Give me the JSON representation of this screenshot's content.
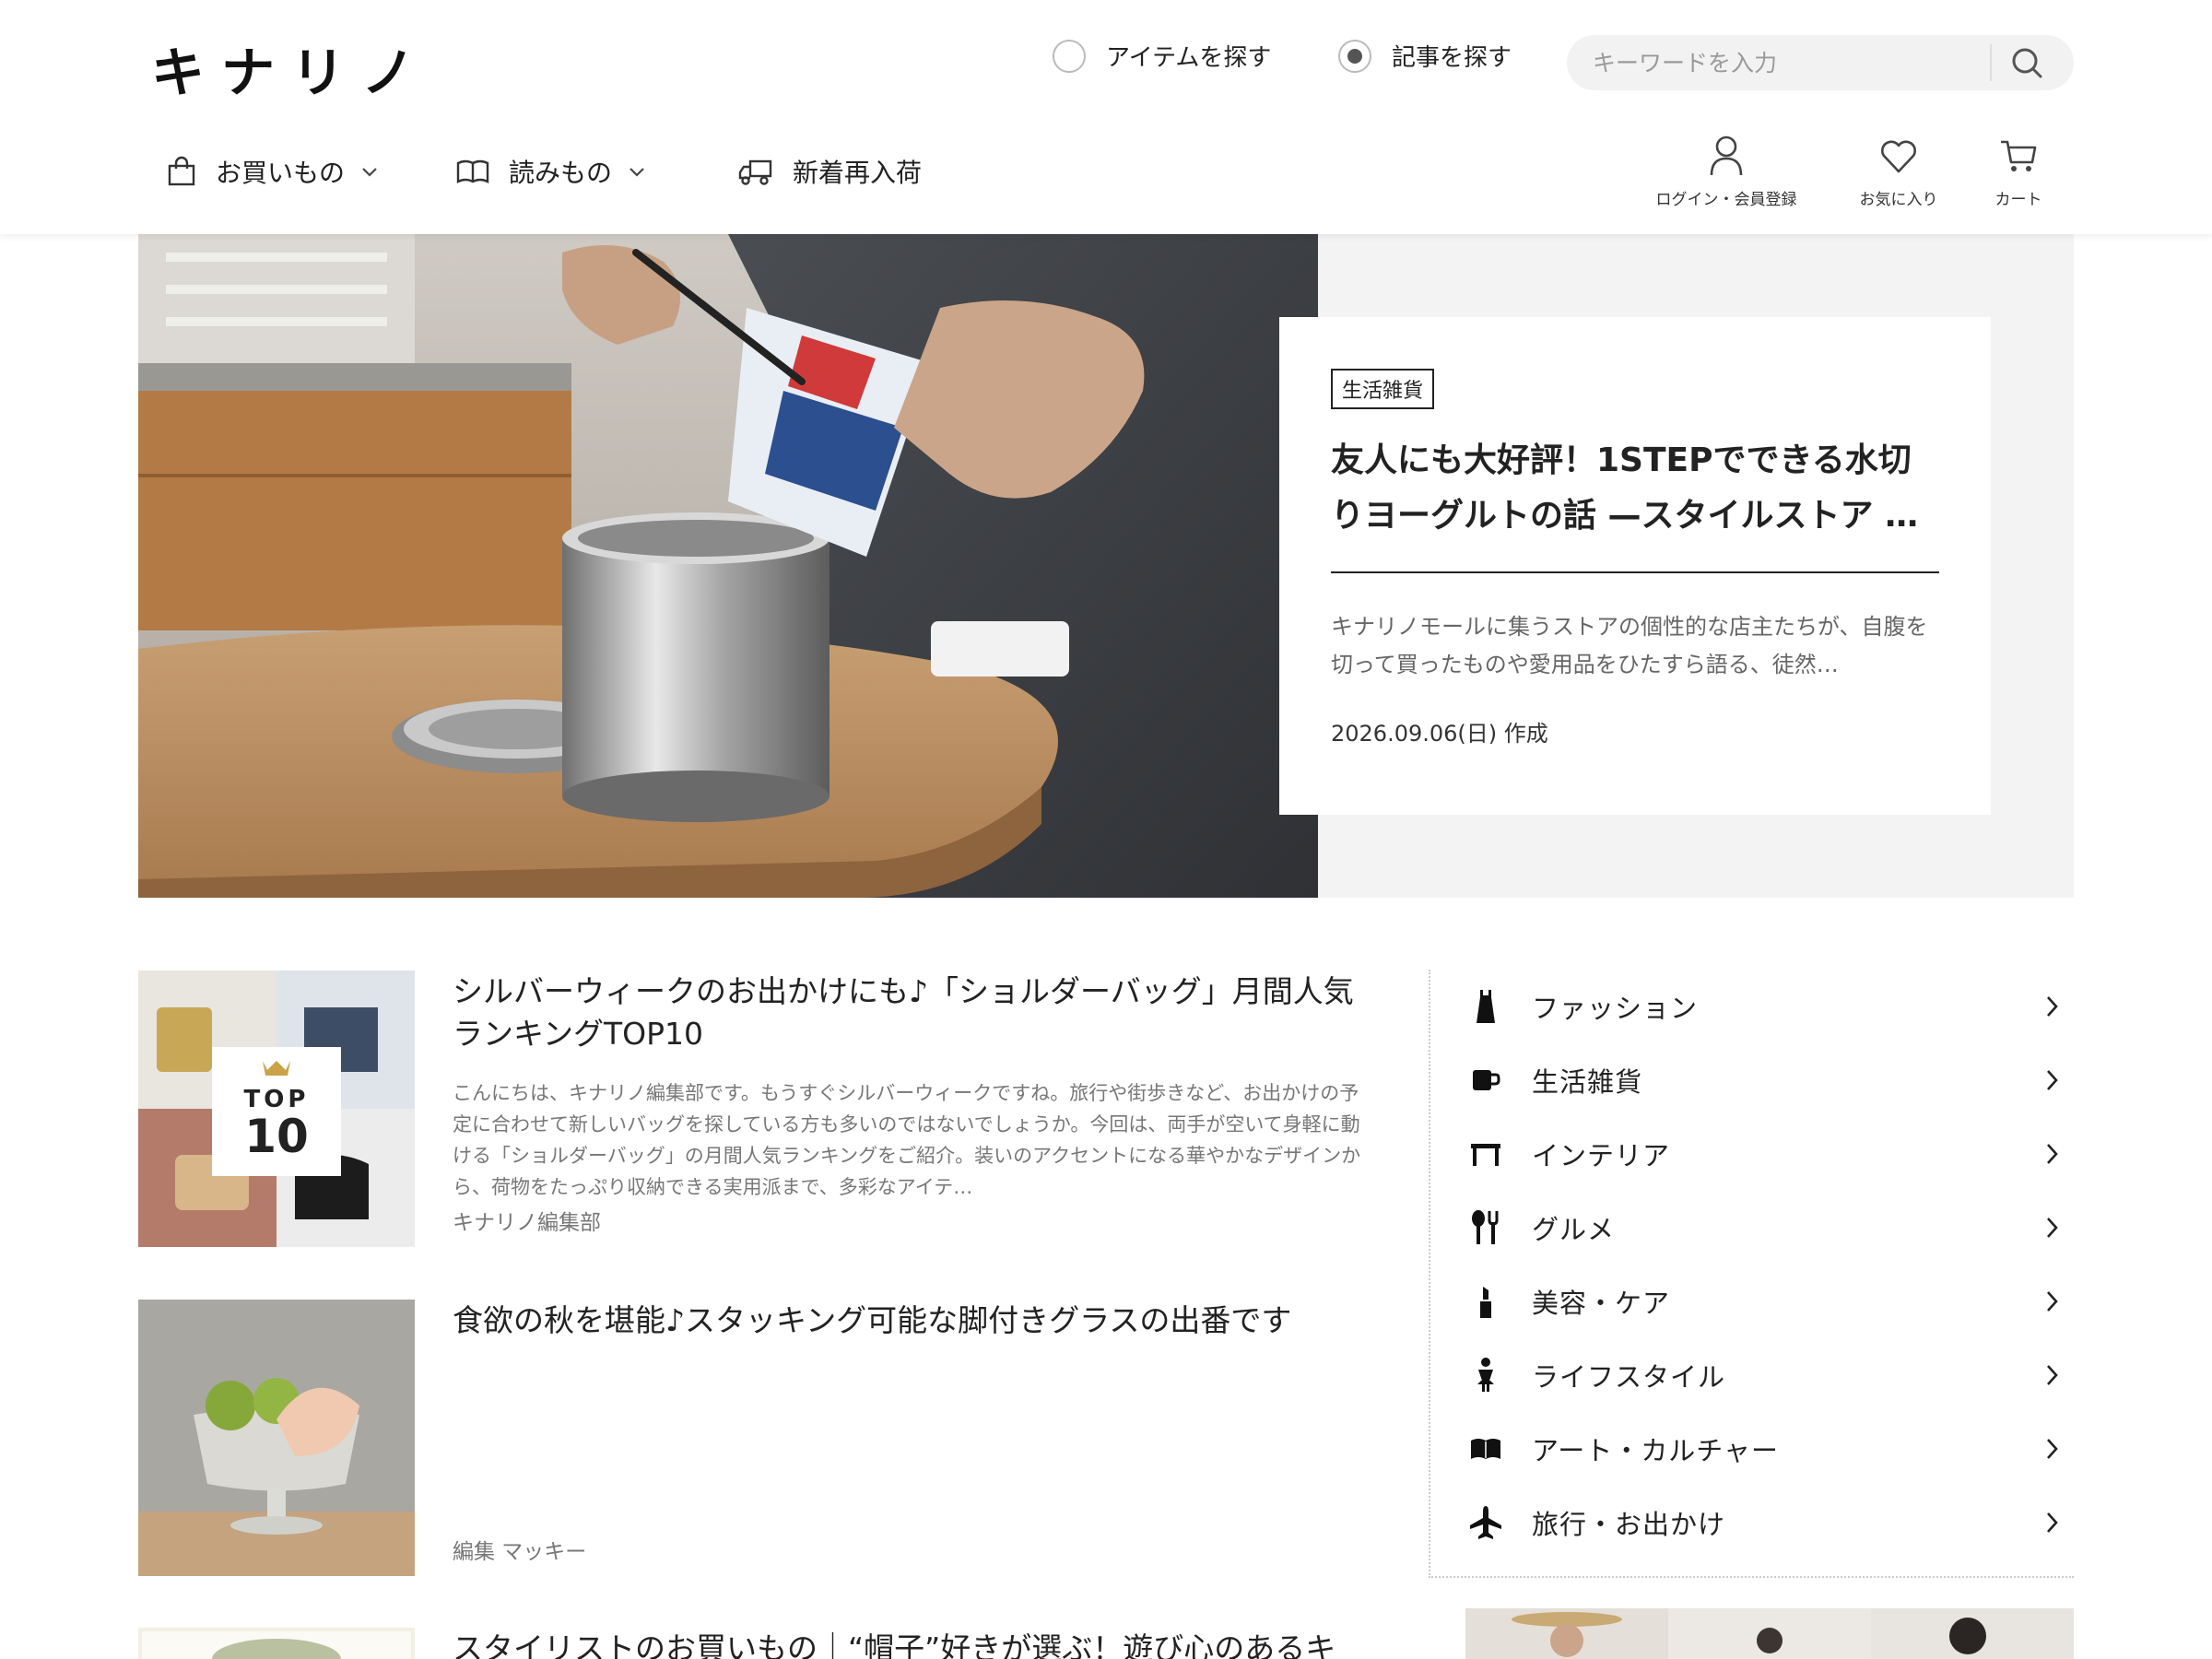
{
  "header": {
    "logo": "キナリノ",
    "search_modes": [
      {
        "label": "アイテムを探す",
        "checked": false
      },
      {
        "label": "記事を探す",
        "checked": true
      }
    ],
    "search_placeholder": "キーワードを入力",
    "nav": [
      {
        "label": "お買いもの",
        "icon": "shopping-bag-icon"
      },
      {
        "label": "読みもの",
        "icon": "open-book-icon"
      },
      {
        "label": "新着再入荷",
        "icon": "delivery-truck-icon"
      }
    ],
    "utility": [
      {
        "label": "ログイン・会員登録",
        "icon": "user-icon"
      },
      {
        "label": "お気に入り",
        "icon": "heart-icon"
      },
      {
        "label": "カート",
        "icon": "cart-icon"
      }
    ]
  },
  "hero": {
    "tag": "生活雑貨",
    "title": "友人にも大好評！1STEPでできる水切りヨーグルトの話 —スタイルストア …",
    "description": "キナリノモールに集うストアの個性的な店主たちが、自腹を切って買ったものや愛用品をひたすら語る、徒然…",
    "date": "2026.09.06(日) 作成"
  },
  "articles": [
    {
      "title": "シルバーウィークのお出かけにも♪「ショルダーバッグ」月間人気ランキングTOP10",
      "description": "こんにちは、キナリノ編集部です。もうすぐシルバーウィークですね。旅行や街歩きなど、お出かけの予定に合わせて新しいバッグを探している方も多いのではないでしょうか。今回は、両手が空いて身軽に動ける「ショルダーバッグ」の月間人気ランキングをご紹介。装いのアクセントになる華やかなデザインから、荷物をたっぷり収納できる実用派まで、多彩なアイテ…",
      "author": "キナリノ編集部",
      "badge_top": "TOP",
      "badge_num": "10"
    },
    {
      "title": "食欲の秋を堪能♪スタッキング可能な脚付きグラスの出番です",
      "description": "",
      "author": "編集 マッキー"
    },
    {
      "title": "スタイリストのお買いもの｜“帽子”好きが選ぶ！遊び心のあるキ",
      "description": "",
      "author": ""
    }
  ],
  "categories": [
    {
      "label": "ファッション",
      "icon": "dress-icon"
    },
    {
      "label": "生活雑貨",
      "icon": "mug-icon"
    },
    {
      "label": "インテリア",
      "icon": "table-icon"
    },
    {
      "label": "グルメ",
      "icon": "fork-spoon-icon"
    },
    {
      "label": "美容・ケア",
      "icon": "lipstick-icon"
    },
    {
      "label": "ライフスタイル",
      "icon": "person-icon"
    },
    {
      "label": "アート・カルチャー",
      "icon": "book-icon"
    },
    {
      "label": "旅行・お出かけ",
      "icon": "airplane-icon"
    }
  ]
}
